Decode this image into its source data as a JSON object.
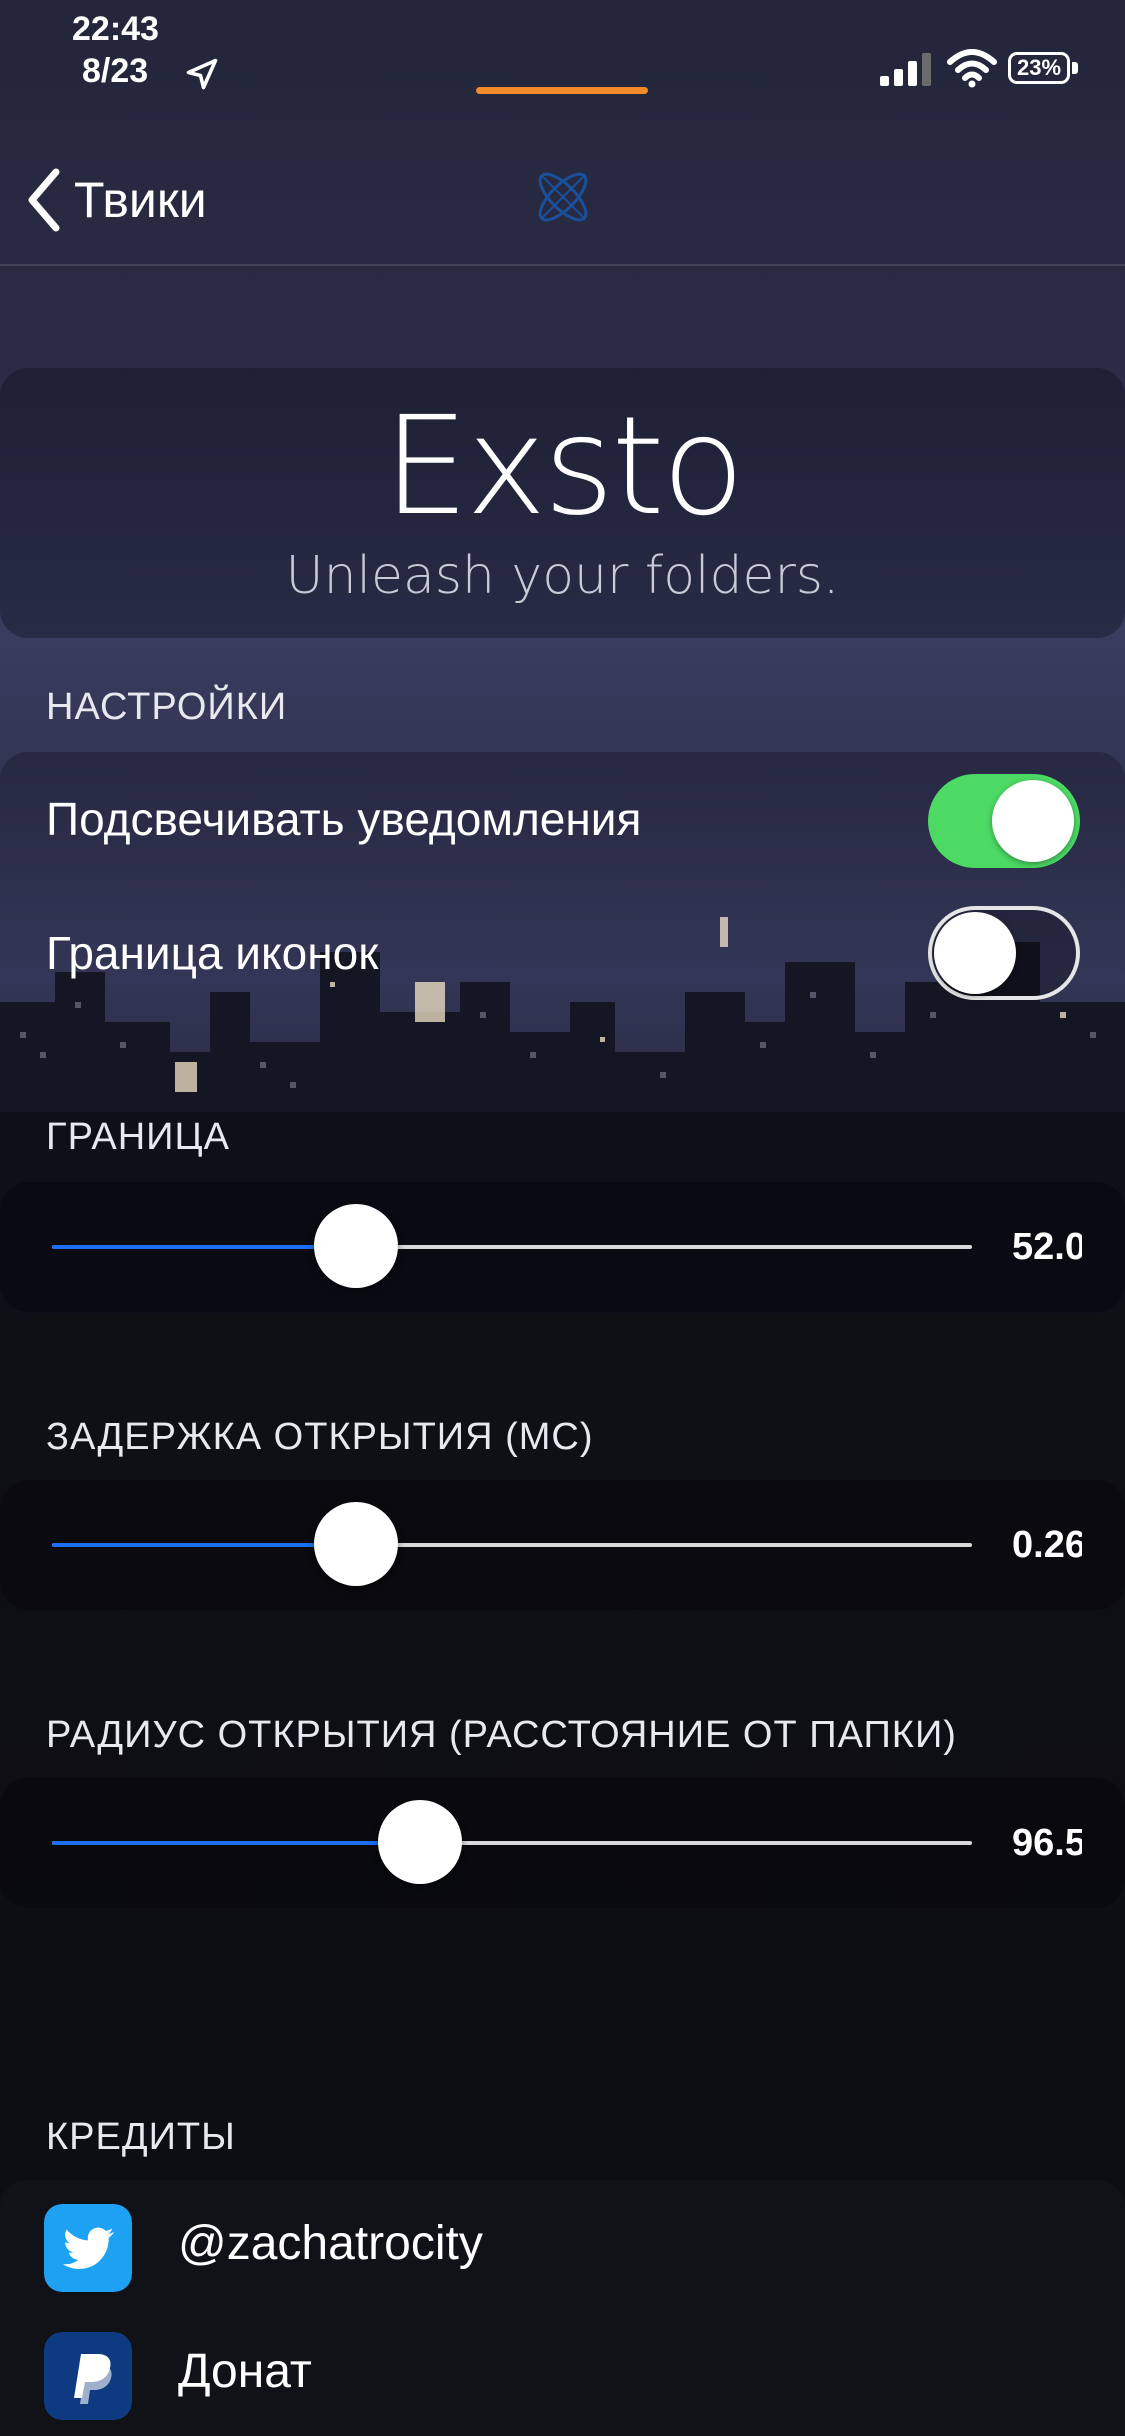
{
  "status_bar": {
    "time": "22:43",
    "date": "8/23",
    "battery": "23%"
  },
  "nav": {
    "back_label": "Твики"
  },
  "header": {
    "title": "Exsto",
    "subtitle": "Unleash your folders."
  },
  "settings": {
    "section_label": "НАСТРОЙКИ",
    "toggles": [
      {
        "label": "Подсвечивать уведомления",
        "on": true
      },
      {
        "label": "Граница иконок",
        "on": false
      }
    ]
  },
  "sliders": [
    {
      "label": "ГРАНИЦА",
      "value_text": "52.0",
      "fraction": 0.33
    },
    {
      "label": "ЗАДЕРЖКА ОТКРЫТИЯ (МС)",
      "value_text": "0.26",
      "fraction": 0.33
    },
    {
      "label": "РАДИУС ОТКРЫТИЯ (РАССТОЯНИЕ ОТ ПАПКИ)",
      "value_text": "96.5",
      "fraction": 0.4
    }
  ],
  "credits": {
    "section_label": "КРЕДИТЫ",
    "items": [
      {
        "label": "@zachatrocity",
        "icon": "twitter-icon"
      },
      {
        "label": "Донат",
        "icon": "paypal-icon"
      }
    ]
  },
  "colors": {
    "accent": "#1b6ff5",
    "toggle_on": "#4cd964",
    "home_indicator": "#f28a2a",
    "twitter": "#1da1f2",
    "paypal": "#0e3a82"
  }
}
